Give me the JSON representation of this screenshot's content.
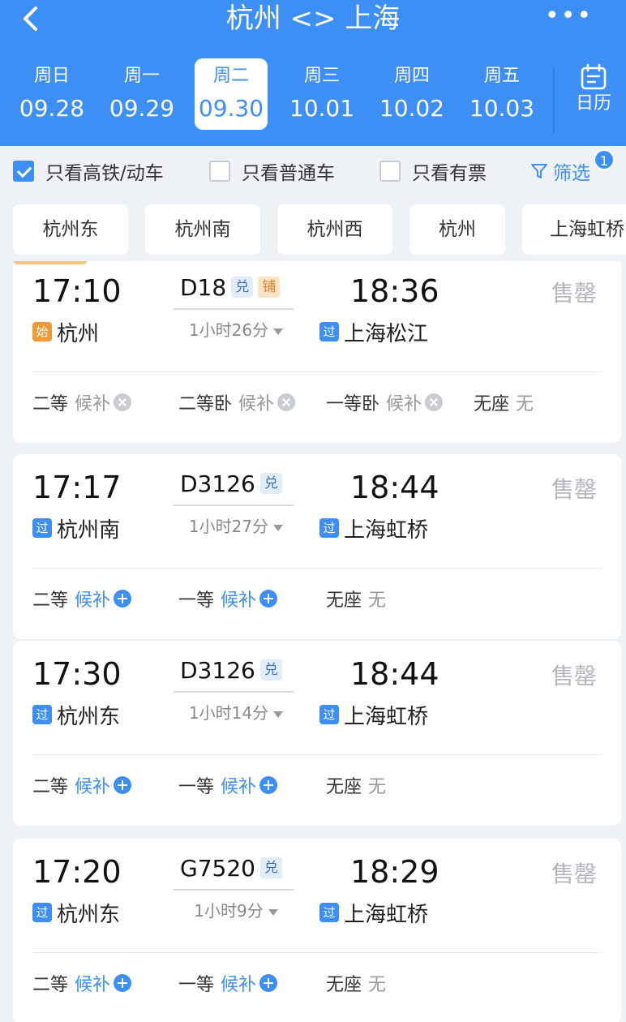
{
  "header": {
    "title": "杭州 <> 上海",
    "back_icon": "back-chevron-icon",
    "more_label": "•••"
  },
  "dates": [
    {
      "weekday": "周日",
      "date": "09.28"
    },
    {
      "weekday": "周一",
      "date": "09.29"
    },
    {
      "weekday": "周二",
      "date": "09.30",
      "selected": true
    },
    {
      "weekday": "周三",
      "date": "10.01"
    },
    {
      "weekday": "周四",
      "date": "10.02"
    },
    {
      "weekday": "周五",
      "date": "10.03"
    }
  ],
  "calendar": {
    "label": "日历",
    "icon": "calendar-icon"
  },
  "filters": {
    "high_speed": {
      "label": "只看高铁/动车",
      "checked": true
    },
    "normal": {
      "label": "只看普通车",
      "checked": false
    },
    "available": {
      "label": "只看有票",
      "checked": false
    },
    "filter_label": "筛选",
    "filter_badge": "1"
  },
  "stations": [
    "杭州东",
    "杭州南",
    "杭州西",
    "杭州",
    "上海虹桥"
  ],
  "trains": [
    {
      "dep_time": "17:10",
      "train_no": "D18",
      "arr_time": "18:36",
      "tags": [
        "兑",
        "铺"
      ],
      "dep_badge": "始",
      "dep_station": "杭州",
      "duration": "1小时26分",
      "arr_badge": "过",
      "arr_station": "上海松江",
      "status": "售罄",
      "seats": [
        {
          "name": "二等",
          "value": "候补"
        },
        {
          "name": "二等卧",
          "value": "候补"
        },
        {
          "name": "一等卧",
          "value": "候补"
        },
        {
          "name": "无座",
          "value": "无"
        }
      ]
    },
    {
      "dep_time": "17:17",
      "train_no": "D3126",
      "arr_time": "18:44",
      "tags": [
        "兑"
      ],
      "dep_badge": "过",
      "dep_station": "杭州南",
      "duration": "1小时27分",
      "arr_badge": "过",
      "arr_station": "上海虹桥",
      "status": "售罄",
      "seats": [
        {
          "name": "二等",
          "value": "候补"
        },
        {
          "name": "一等",
          "value": "候补"
        },
        {
          "name": "无座",
          "value": "无"
        }
      ]
    },
    {
      "dep_time": "17:30",
      "train_no": "D3126",
      "arr_time": "18:44",
      "tags": [
        "兑"
      ],
      "dep_badge": "过",
      "dep_station": "杭州东",
      "duration": "1小时14分",
      "arr_badge": "过",
      "arr_station": "上海虹桥",
      "status": "售罄",
      "seats": [
        {
          "name": "二等",
          "value": "候补"
        },
        {
          "name": "一等",
          "value": "候补"
        },
        {
          "name": "无座",
          "value": "无"
        }
      ]
    },
    {
      "dep_time": "17:20",
      "train_no": "G7520",
      "arr_time": "18:29",
      "tags": [
        "兑"
      ],
      "dep_badge": "过",
      "dep_station": "杭州东",
      "duration": "1小时9分",
      "arr_badge": "过",
      "arr_station": "上海虹桥",
      "status": "售罄",
      "seats": [
        {
          "name": "二等",
          "value": "候补"
        },
        {
          "name": "一等",
          "value": "候补"
        },
        {
          "name": "无座",
          "value": "无"
        }
      ]
    }
  ],
  "colors": {
    "accent": "#3d8ff5",
    "start_badge": "#f09a36",
    "sold_out": "#b2b6bb"
  }
}
